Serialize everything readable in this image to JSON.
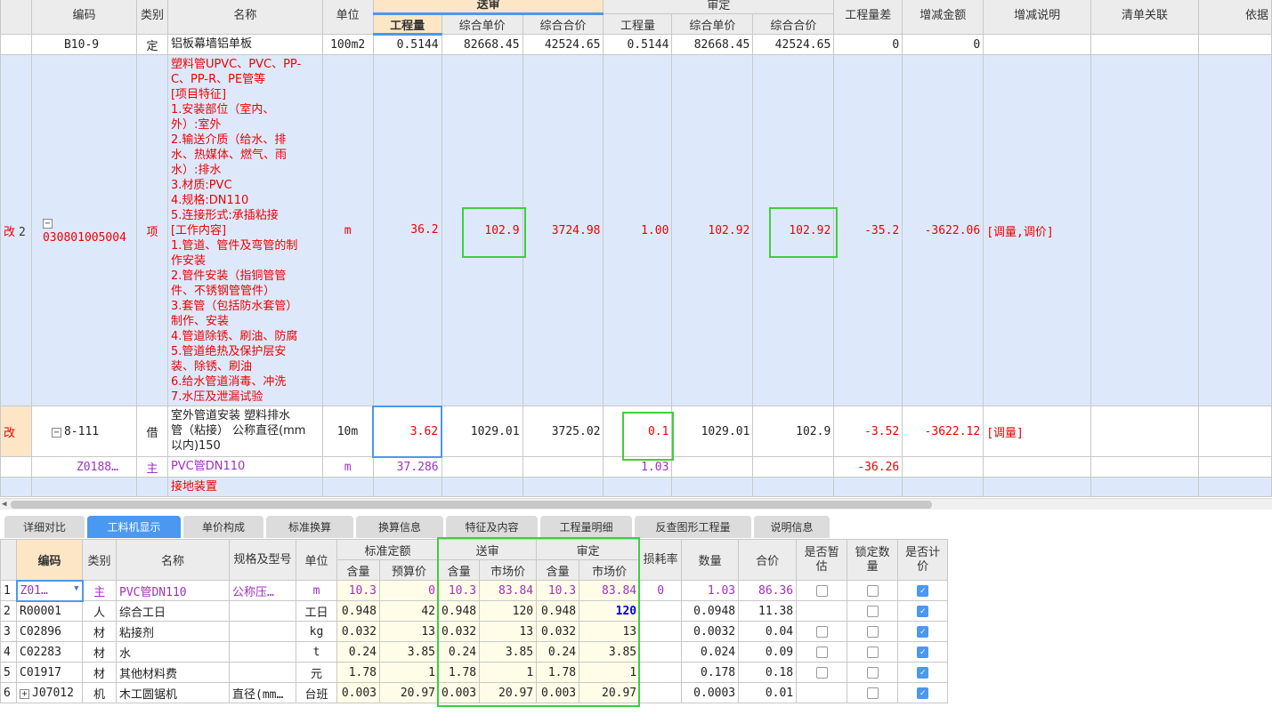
{
  "top_table": {
    "group_headers": {
      "submitted": "送审",
      "approved": "审定"
    },
    "headers": {
      "code": "编码",
      "type": "类别",
      "name": "名称",
      "unit": "单位",
      "qty": "工程量",
      "unit_price": "综合单价",
      "total": "综合合价",
      "qty_diff": "工程量差",
      "amount_change": "增减金额",
      "change_note": "增减说明",
      "list_link": "清单关联",
      "basis": "依据"
    },
    "rows": [
      {
        "flag": "",
        "num": "",
        "code": "B10-9",
        "type": "定",
        "name": [
          "铝板幕墙铝单板"
        ],
        "unit": "100m2",
        "ss_qty": "0.5144",
        "ss_price": "82668.45",
        "ss_total": "42524.65",
        "sd_qty": "0.5144",
        "sd_price": "82668.45",
        "sd_total": "42524.65",
        "qty_diff": "0",
        "amount": "0",
        "note": "",
        "style": "normal"
      },
      {
        "flag": "改",
        "num": "2",
        "code": "030801005004",
        "type": "项",
        "name": [
          "塑料管UPVC、PVC、PP-",
          "C、PP-R、PE管等",
          "[项目特征]",
          "1.安装部位（室内、",
          "外）:室外",
          "2.输送介质（给水、排",
          "水、热媒体、燃气、雨",
          "水）:排水",
          "3.材质:PVC",
          "4.规格:DN110",
          "5.连接形式:承插粘接",
          "[工作内容]",
          "1.管道、管件及弯管的制",
          "作安装",
          "2.管件安装（指铜管管",
          "件、不锈钢管管件）",
          "3.套管（包括防水套管）",
          "制作、安装",
          "4.管道除锈、刷油、防腐",
          "5.管道绝热及保护层安",
          "装、除锈、刷油",
          "6.给水管道消毒、冲洗",
          "7.水压及泄漏试验"
        ],
        "unit": "m",
        "ss_qty": "36.2",
        "ss_price": "102.9",
        "ss_total": "3724.98",
        "sd_qty": "1.00",
        "sd_price": "102.92",
        "sd_total": "102.92",
        "qty_diff": "-35.2",
        "amount": "-3622.06",
        "note": "[调量,调价]",
        "style": "list"
      },
      {
        "flag": "改",
        "num": "",
        "code": "8-111",
        "type": "借",
        "name": [
          "室外管道安装 塑料排水",
          "管（粘接） 公称直径(mm",
          "以内)150"
        ],
        "unit": "10m",
        "ss_qty": "3.62",
        "ss_price": "1029.01",
        "ss_total": "3725.02",
        "sd_qty": "0.1",
        "sd_price": "1029.01",
        "sd_total": "102.9",
        "qty_diff": "-3.52",
        "amount": "-3622.12",
        "note": "[调量]",
        "style": "quota"
      },
      {
        "flag": "",
        "num": "",
        "code": "Z0188…",
        "type": "主",
        "name": [
          "PVC管DN110"
        ],
        "unit": "m",
        "ss_qty": "37.286",
        "ss_price": "",
        "ss_total": "",
        "sd_qty": "1.03",
        "sd_price": "",
        "sd_total": "",
        "qty_diff": "-36.26",
        "amount": "",
        "note": "",
        "style": "material"
      },
      {
        "flag": "",
        "num": "",
        "code": "",
        "type": "",
        "name": [
          "接地装置"
        ],
        "unit": "",
        "ss_qty": "",
        "ss_price": "",
        "ss_total": "",
        "sd_qty": "",
        "sd_price": "",
        "sd_total": "",
        "qty_diff": "",
        "amount": "",
        "note": "",
        "style": "list-cut"
      }
    ]
  },
  "tabs": [
    {
      "label": "详细对比",
      "active": false
    },
    {
      "label": "工料机显示",
      "active": true
    },
    {
      "label": "单价构成",
      "active": false
    },
    {
      "label": "标准换算",
      "active": false
    },
    {
      "label": "换算信息",
      "active": false
    },
    {
      "label": "特征及内容",
      "active": false
    },
    {
      "label": "工程量明细",
      "active": false
    },
    {
      "label": "反查图形工程量",
      "active": false
    },
    {
      "label": "说明信息",
      "active": false
    }
  ],
  "bottom_table": {
    "headers": {
      "code": "编码",
      "type": "类别",
      "name": "名称",
      "spec": "规格及型号",
      "unit": "单位",
      "std_group": "标准定额",
      "ss_group": "送审",
      "sd_group": "审定",
      "content": "含量",
      "budget_price": "预算价",
      "market_price": "市场价",
      "loss_rate": "损耗率",
      "quantity": "数量",
      "total": "合价",
      "provisional": "是否暂估",
      "lock_qty": "锁定数量",
      "priced": "是否计价"
    },
    "rows": [
      {
        "no": "1",
        "code": "Z01…",
        "type": "主",
        "name": "PVC管DN110",
        "spec": "公称压…",
        "unit": "m",
        "std_c": "10.3",
        "std_p": "0",
        "ss_c": "10.3",
        "ss_p": "83.84",
        "sd_c": "10.3",
        "sd_p": "83.84",
        "loss": "0",
        "qty": "1.03",
        "total": "86.36",
        "provisional": false,
        "lock": false,
        "priced": true,
        "has_prov": true,
        "purple": true
      },
      {
        "no": "2",
        "code": "R00001",
        "type": "人",
        "name": "综合工日",
        "spec": "",
        "unit": "工日",
        "std_c": "0.948",
        "std_p": "42",
        "ss_c": "0.948",
        "ss_p": "120",
        "sd_c": "0.948",
        "sd_p": "120",
        "loss": "",
        "qty": "0.0948",
        "total": "11.38",
        "provisional": false,
        "lock": false,
        "priced": true,
        "has_prov": false,
        "purple": false,
        "sd_p_blue": true
      },
      {
        "no": "3",
        "code": "C02896",
        "type": "材",
        "name": "粘接剂",
        "spec": "",
        "unit": "kg",
        "std_c": "0.032",
        "std_p": "13",
        "ss_c": "0.032",
        "ss_p": "13",
        "sd_c": "0.032",
        "sd_p": "13",
        "loss": "",
        "qty": "0.0032",
        "total": "0.04",
        "provisional": false,
        "lock": false,
        "priced": true,
        "has_prov": true,
        "purple": false
      },
      {
        "no": "4",
        "code": "C02283",
        "type": "材",
        "name": "水",
        "spec": "",
        "unit": "t",
        "std_c": "0.24",
        "std_p": "3.85",
        "ss_c": "0.24",
        "ss_p": "3.85",
        "sd_c": "0.24",
        "sd_p": "3.85",
        "loss": "",
        "qty": "0.024",
        "total": "0.09",
        "provisional": false,
        "lock": false,
        "priced": true,
        "has_prov": true,
        "purple": false
      },
      {
        "no": "5",
        "code": "C01917",
        "type": "材",
        "name": "其他材料费",
        "spec": "",
        "unit": "元",
        "std_c": "1.78",
        "std_p": "1",
        "ss_c": "1.78",
        "ss_p": "1",
        "sd_c": "1.78",
        "sd_p": "1",
        "loss": "",
        "qty": "0.178",
        "total": "0.18",
        "provisional": false,
        "lock": false,
        "priced": true,
        "has_prov": true,
        "purple": false
      },
      {
        "no": "6",
        "code": "J07012",
        "type": "机",
        "name": "木工圆锯机",
        "spec": "直径(mm…",
        "unit": "台班",
        "std_c": "0.003",
        "std_p": "20.97",
        "ss_c": "0.003",
        "ss_p": "20.97",
        "sd_c": "0.003",
        "sd_p": "20.97",
        "loss": "",
        "qty": "0.0003",
        "total": "0.01",
        "provisional": false,
        "lock": false,
        "priced": true,
        "has_prov": false,
        "purple": false,
        "expandable": true
      }
    ]
  }
}
